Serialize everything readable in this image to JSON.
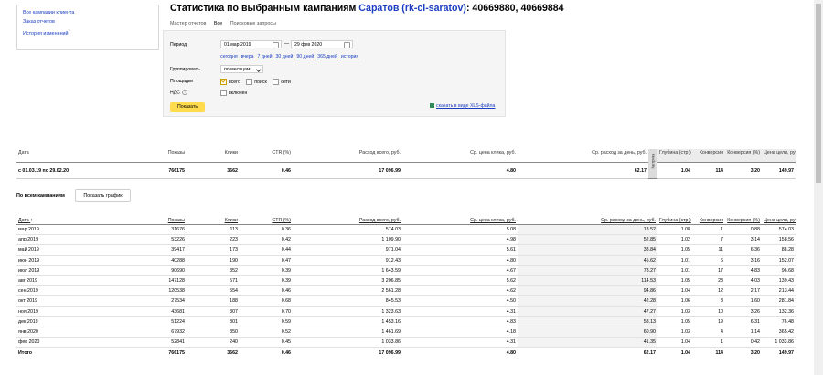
{
  "nav": {
    "links": [
      "Все кампании клиента",
      "Заказ отчетов",
      "История изменений"
    ],
    "history_mark": "?"
  },
  "header": {
    "title_prefix": "Статистика по выбранным кампаниям",
    "client_link": "Саратов (rk-cl-saratov)",
    "title_suffix": ": 40669880, 40669884"
  },
  "tabs": [
    {
      "label": "Мастер отчетов",
      "active": false
    },
    {
      "label": "Все",
      "active": true
    },
    {
      "label": "Поисковые запросы",
      "active": false
    }
  ],
  "filters": {
    "period_label": "Период",
    "date_from": "01 мар 2019",
    "date_sep": "—",
    "date_to": "29 фев 2020",
    "quick_links": [
      "сегодня",
      "вчера",
      "7 дней",
      "30 дней",
      "90 дней",
      "365 дней",
      "история"
    ],
    "group_label": "Группировать",
    "group_value": "по месяцам",
    "placements_label": "Площадки",
    "placements": [
      {
        "label": "всего",
        "checked": true
      },
      {
        "label": "поиск",
        "checked": false
      },
      {
        "label": "сети",
        "checked": false
      }
    ],
    "vat_label": "НДС",
    "vat_info": "?",
    "vat_option": "включен",
    "vat_checked": false,
    "show_button": "Показать",
    "xls_link": "скачать в виде XLS-файла"
  },
  "summary": {
    "headers": [
      "Дата",
      "Показы",
      "Клики",
      "CTR (%)",
      "Расход всего, руб.",
      "Ср. цена клика, руб.",
      "Ср. расход за день, руб.",
      "Метрика",
      "Глубина (стр.)",
      "Конверсии",
      "Конверсия (%)",
      "Цена цели, руб."
    ],
    "row": [
      "с 01.03.19 по 29.02.20",
      "766175",
      "3562",
      "0.46",
      "17 096.99",
      "4.80",
      "62.17",
      "",
      "1.04",
      "114",
      "3.20",
      "149.97"
    ]
  },
  "section": {
    "title": "По всем кампаниям",
    "chart_button": "Показать график"
  },
  "table": {
    "headers": [
      "Дата",
      "Показы",
      "Клики",
      "CTR (%)",
      "Расход всего, руб.",
      "Ср. цена клика, руб.",
      "Ср. расход за день, руб.",
      "Глубина (стр.)",
      "Конверсии",
      "Конверсия (%)",
      "Цена цели, руб."
    ],
    "date_sort_mark": "↑",
    "rows": [
      [
        "мар 2019",
        "31676",
        "113",
        "0.36",
        "574.03",
        "5.08",
        "18.52",
        "1.08",
        "1",
        "0.88",
        "574.03"
      ],
      [
        "апр 2019",
        "53226",
        "223",
        "0.42",
        "1 109.90",
        "4.98",
        "52.85",
        "1.02",
        "7",
        "3.14",
        "158.56"
      ],
      [
        "май 2019",
        "39417",
        "173",
        "0.44",
        "971.04",
        "5.61",
        "38.84",
        "1.05",
        "11",
        "6.36",
        "88.28"
      ],
      [
        "июн 2019",
        "40288",
        "190",
        "0.47",
        "912.43",
        "4.80",
        "45.62",
        "1.01",
        "6",
        "3.16",
        "152.07"
      ],
      [
        "июл 2019",
        "90690",
        "352",
        "0.39",
        "1 643.59",
        "4.67",
        "78.27",
        "1.01",
        "17",
        "4.83",
        "96.68"
      ],
      [
        "авг 2019",
        "147128",
        "571",
        "0.39",
        "3 206.85",
        "5.62",
        "114.53",
        "1.05",
        "23",
        "4.03",
        "139.43"
      ],
      [
        "сен 2019",
        "120538",
        "554",
        "0.46",
        "2 561.28",
        "4.62",
        "94.86",
        "1.04",
        "12",
        "2.17",
        "213.44"
      ],
      [
        "окт 2019",
        "27534",
        "188",
        "0.68",
        "845.53",
        "4.50",
        "42.28",
        "1.06",
        "3",
        "1.60",
        "281.84"
      ],
      [
        "ноя 2019",
        "43681",
        "307",
        "0.70",
        "1 323.63",
        "4.31",
        "47.27",
        "1.03",
        "10",
        "3.26",
        "132.36"
      ],
      [
        "дек 2019",
        "51224",
        "301",
        "0.59",
        "1 453.16",
        "4.83",
        "58.13",
        "1.05",
        "19",
        "6.31",
        "76.48"
      ],
      [
        "янв 2020",
        "67932",
        "350",
        "0.52",
        "1 461.69",
        "4.18",
        "60.90",
        "1.03",
        "4",
        "1.14",
        "365.42"
      ],
      [
        "фев 2020",
        "52841",
        "240",
        "0.45",
        "1 033.86",
        "4.31",
        "41.35",
        "1.04",
        "1",
        "0.42",
        "1 033.86"
      ]
    ],
    "total": [
      "Итого",
      "766175",
      "3562",
      "0.46",
      "17 096.99",
      "4.80",
      "62.17",
      "1.04",
      "114",
      "3.20",
      "149.97"
    ]
  }
}
